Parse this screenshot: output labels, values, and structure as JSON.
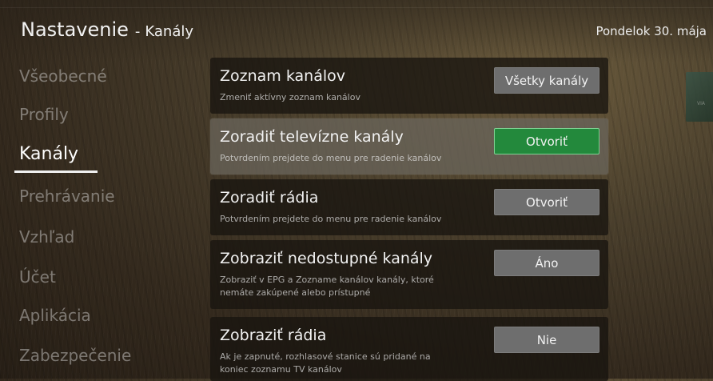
{
  "header": {
    "title": "Nastavenie",
    "separator": "-",
    "section": "Kanály",
    "date": "Pondelok 30. mája"
  },
  "nav": {
    "items": [
      {
        "label": "Všeobecné"
      },
      {
        "label": "Profily"
      },
      {
        "label": "Kanály"
      },
      {
        "label": "Prehrávanie"
      },
      {
        "label": "Vzhľad"
      },
      {
        "label": "Účet"
      },
      {
        "label": "Aplikácia"
      },
      {
        "label": "Zabezpečenie"
      }
    ],
    "active": "Kanály"
  },
  "settings": [
    {
      "title": "Zoznam kanálov",
      "description": "Zmeniť aktívny zoznam kanálov",
      "button": "Všetky kanály"
    },
    {
      "title": "Zoradiť televízne kanály",
      "description": "Potvrdením prejdete do menu pre radenie kanálov",
      "button": "Otvoriť"
    },
    {
      "title": "Zoradiť rádia",
      "description": "Potvrdením prejdete do menu pre radenie kanálov",
      "button": "Otvoriť"
    },
    {
      "title": "Zobraziť nedostupné kanály",
      "description": "Zobraziť v EPG a Zozname kanálov kanály, ktoré nemáte zakúpené alebo prístupné",
      "button": "Áno"
    },
    {
      "title": "Zobraziť rádia",
      "description": "Ak je zapnuté, rozhlasové stanice sú pridané na koniec zoznamu TV kanálov",
      "button": "Nie"
    }
  ],
  "background_text": "VIA",
  "colors": {
    "accent_green": "#23893c",
    "button_gray": "#6e6e6e",
    "panel_highlight": "#69645a"
  }
}
